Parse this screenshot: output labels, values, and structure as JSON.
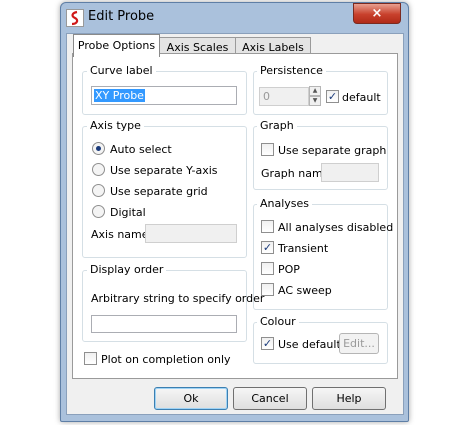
{
  "window": {
    "title": "Edit Probe",
    "close_icon": "×"
  },
  "tabs": [
    {
      "label": "Probe Options",
      "active": true
    },
    {
      "label": "Axis Scales",
      "active": false
    },
    {
      "label": "Axis Labels",
      "active": false
    }
  ],
  "curve_label": {
    "title": "Curve label",
    "value": "XY Probe"
  },
  "persistence": {
    "title": "Persistence",
    "value": "0",
    "default_label": "default",
    "default_checked": true
  },
  "axis_type": {
    "title": "Axis type",
    "options": [
      {
        "label": "Auto select",
        "selected": true
      },
      {
        "label": "Use separate Y-axis",
        "selected": false
      },
      {
        "label": "Use separate grid",
        "selected": false
      },
      {
        "label": "Digital",
        "selected": false
      }
    ],
    "axis_name_label": "Axis name",
    "axis_name_value": ""
  },
  "graph": {
    "title": "Graph",
    "use_separate_label": "Use separate graph",
    "use_separate_checked": false,
    "graph_name_label": "Graph name",
    "graph_name_value": ""
  },
  "analyses": {
    "title": "Analyses",
    "items": [
      {
        "label": "All analyses disabled",
        "checked": false
      },
      {
        "label": "Transient",
        "checked": true
      },
      {
        "label": "POP",
        "checked": false
      },
      {
        "label": "AC sweep",
        "checked": false
      }
    ]
  },
  "display_order": {
    "title": "Display order",
    "hint": "Arbitrary string to specify order",
    "value": ""
  },
  "colour": {
    "title": "Colour",
    "use_default_label": "Use default",
    "use_default_checked": true,
    "edit_label": "Edit..."
  },
  "plot_on_completion": {
    "label": "Plot on completion only",
    "checked": false
  },
  "buttons": {
    "ok": "Ok",
    "cancel": "Cancel",
    "help": "Help"
  }
}
